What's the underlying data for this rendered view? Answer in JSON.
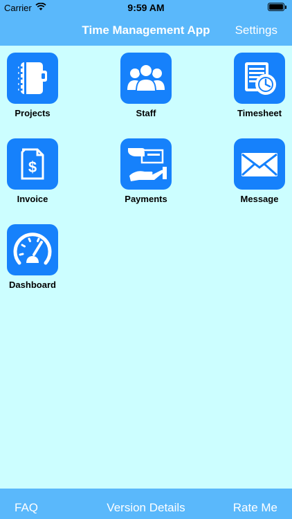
{
  "status_bar": {
    "carrier": "Carrier",
    "time": "9:59 AM"
  },
  "nav": {
    "title": "Time Management App",
    "settings_label": "Settings"
  },
  "tiles": [
    {
      "label": "Projects",
      "icon": "notebook-icon"
    },
    {
      "label": "Staff",
      "icon": "staff-group-icon"
    },
    {
      "label": "Timesheet",
      "icon": "timesheet-clock-icon"
    },
    {
      "label": "Invoice",
      "icon": "invoice-dollar-icon"
    },
    {
      "label": "Payments",
      "icon": "payments-hand-icon"
    },
    {
      "label": "Message",
      "icon": "envelope-icon"
    },
    {
      "label": "Dashboard",
      "icon": "speedometer-icon"
    }
  ],
  "bottom_bar": {
    "faq_label": "FAQ",
    "version_label": "Version Details",
    "rate_label": "Rate Me"
  },
  "colors": {
    "bar": "#5ab8fb",
    "background": "#ccfeff",
    "tile": "#1681fb"
  }
}
